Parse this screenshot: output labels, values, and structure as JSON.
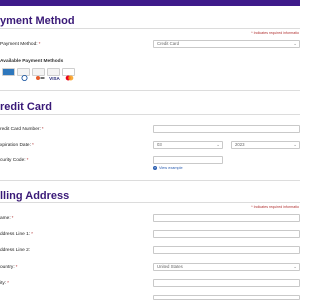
{
  "payment_method_section": {
    "title": "yment Method",
    "required_note": "* Indicates required informatio",
    "payment_method_label": "Payment Method:",
    "payment_method_value": "Credit Card",
    "available_label": "Available Payment Methods",
    "cards": [
      "amex-card-icon",
      "diners-card-icon",
      "discover-card-icon",
      "visa-card-icon",
      "mastercard-card-icon"
    ]
  },
  "credit_card_section": {
    "title": "redit Card",
    "card_number_label": "redit Card Number:",
    "expiration_label": "xpiration Date:",
    "exp_month": "03",
    "exp_year": "2023",
    "security_code_label": "curity Code:",
    "view_example": "View example"
  },
  "billing_section": {
    "title": "lling Address",
    "required_note": "* Indicates required informatio",
    "name_label": "ame:",
    "address1_label": "ddress Line 1:",
    "address2_label": "ddress Line 2:",
    "country_label": "ountry:",
    "country_value": "United States",
    "city_label": "ity:"
  },
  "colors": {
    "accent": "#3a1a78",
    "topbar": "#3e1a8a",
    "required": "#b03030",
    "link": "#2a5db0"
  }
}
